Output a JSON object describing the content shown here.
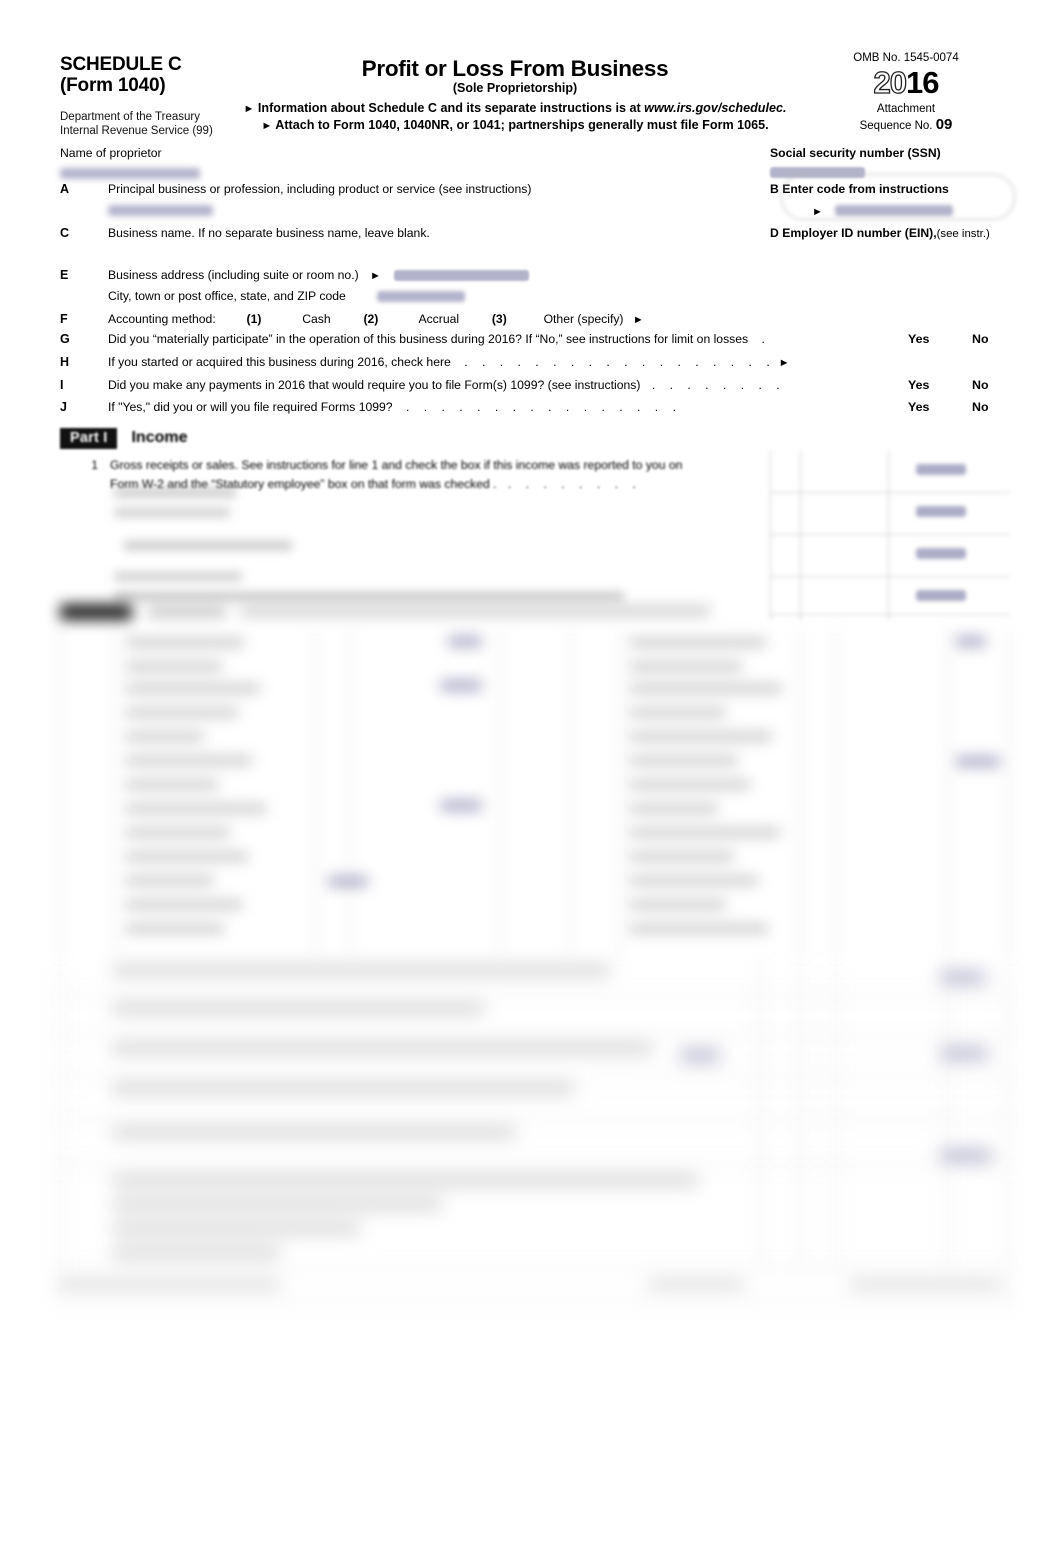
{
  "form": {
    "schedule_title_line1": "SCHEDULE C",
    "schedule_title_line2": "(Form 1040)",
    "department_line1": "Department of the Treasury",
    "department_line2": "Internal Revenue Service (99)",
    "main_title": "Profit or Loss From Business",
    "sub_title": "(Sole Proprietorship)",
    "info_line": "Information about Schedule C and its separate instructions is at ",
    "info_url": "www.irs.gov/schedulec.",
    "attach_line": "Attach to Form 1040, 1040NR, or 1041; partnerships generally must file Form 1065.",
    "omb": "OMB No. 1545-0074",
    "year_light": "20",
    "year_bold": "16",
    "attachment_label": "Attachment",
    "sequence_label": "Sequence No.",
    "sequence_number": "09"
  },
  "identity": {
    "name_label": "Name of proprietor",
    "name_value": "",
    "ssn_label": "Social security number (SSN)",
    "ssn_value": ""
  },
  "lines": {
    "a_letter": "A",
    "a_label": "Principal business or profession, including product or service (see instructions)",
    "a_value": "",
    "b_letter": "B",
    "b_label": "Enter code from instructions",
    "b_value": "",
    "c_letter": "C",
    "c_label": "Business name. If no separate business name, leave blank.",
    "c_value": "",
    "d_letter": "D",
    "d_label": "Employer ID number (EIN),",
    "d_label_small": "(see instr.)",
    "d_value": "",
    "e_letter": "E",
    "e_label": "Business address (including suite or room no.)",
    "e_value": "",
    "e_label2": "City, town or post office, state, and ZIP code",
    "e_value2": "",
    "f_letter": "F",
    "f_label": "Accounting method:",
    "f_opt1_num": "(1)",
    "f_opt1": "Cash",
    "f_opt2_num": "(2)",
    "f_opt2": "Accrual",
    "f_opt3_num": "(3)",
    "f_opt3": "Other (specify)",
    "g_letter": "G",
    "g_label": "Did you “materially participate” in the operation of this business during 2016? If “No,” see instructions for limit on losses",
    "h_letter": "H",
    "h_label": "If you started or acquired this business during 2016, check here",
    "i_letter": "I",
    "i_label": "Did you make any payments in 2016 that would require you to file Form(s) 1099? (see instructions)",
    "j_letter": "J",
    "j_label": "If \"Yes,\" did you or will you file required Forms 1099?",
    "yes": "Yes",
    "no": "No"
  },
  "part1": {
    "badge": "Part I",
    "title": "Income",
    "line1_num": "1",
    "line1_text_a": "Gross receipts or sales. See instructions for line 1 and check the box if this income was reported to you on",
    "line1_text_b": "Form W-2 and the “Statutory employee” box on that form was checked ."
  },
  "colors": {
    "redaction": "#a9a9c4",
    "value_blue": "#9d9dbd",
    "rule": "#9a9a9a",
    "badge_black": "#111111"
  }
}
